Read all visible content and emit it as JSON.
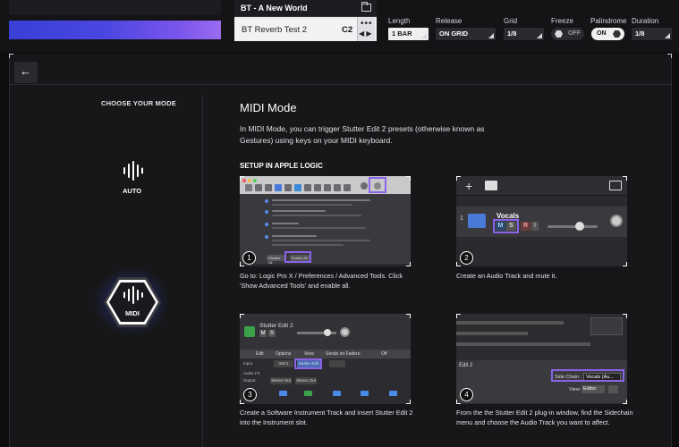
{
  "header": {
    "preset_bank": "BT - A New World",
    "preset_name": "BT Reverb Test 2",
    "preset_key": "C2",
    "more_glyph": "•••",
    "length": {
      "label": "Length",
      "value": "1 BAR"
    },
    "release": {
      "label": "Release",
      "value": "ON GRID"
    },
    "grid": {
      "label": "Grid",
      "value": "1/8"
    },
    "freeze": {
      "label": "Freeze",
      "value": "OFF"
    },
    "palindrome": {
      "label": "Palindrome",
      "value": "ON"
    },
    "duration": {
      "label": "Duration",
      "value": "1/8"
    }
  },
  "sidebar": {
    "title": "CHOOSE YOUR MODE",
    "modes": [
      {
        "label": "AUTO",
        "selected": false
      },
      {
        "label": "MIDI",
        "selected": true
      }
    ]
  },
  "main": {
    "title": "MIDI Mode",
    "description": "In MIDI Mode, you can trigger Stutter Edit 2 presets (otherwise known as Gestures) using keys on your MIDI keyboard.",
    "setup_title": "SETUP IN APPLE LOGIC",
    "steps": [
      {
        "number": "1",
        "caption": "Go to: Logic Pro X / Preferences / Advanced Tools. Click 'Show Advanced Tools' and enable all.",
        "buttons": [
          "Disable All",
          "Enable All"
        ]
      },
      {
        "number": "2",
        "caption": "Create an Audio Track and mute it.",
        "track_name": "Vocals",
        "buttons": [
          "M",
          "S",
          "R",
          "I"
        ]
      },
      {
        "number": "3",
        "caption": "Create a Software Instrument Track and insert Stutter Edit 2 into the Instrument slot.",
        "plugin_title": "Stutter Edit 2",
        "buttons": [
          "M",
          "S"
        ],
        "menu": [
          "Edit",
          "Options",
          "View",
          "Sends on Faders:",
          "Off"
        ],
        "rows": [
          {
            "label": "Input",
            "cells": [
              "Inst 1",
              "Stutter Edit"
            ]
          },
          {
            "label": "Audio FX",
            "cells": []
          },
          {
            "label": "Output",
            "cells": [
              "Stereo Out",
              "Stereo Out"
            ]
          }
        ]
      },
      {
        "number": "4",
        "caption": "From the the Stutter Edit 2 plug-in window, find the Sidechain menu and choose the Audio Track you want to affect.",
        "window_title": "Edit 2",
        "sidechain_label": "Side Chain",
        "sidechain_value": "Vocals (Au...",
        "view_label": "View:",
        "view_value": "Editor"
      }
    ]
  },
  "colors": {
    "accent_purple": "#8a63e8",
    "waveform_start": "#3a3fd6",
    "waveform_end": "#9a6cf0",
    "midi_glow": "#466ed0"
  },
  "icons": {
    "back": "arrow-left-icon",
    "folder": "folder-icon",
    "auto": "waveform-icon",
    "midi": "waveform-icon"
  }
}
